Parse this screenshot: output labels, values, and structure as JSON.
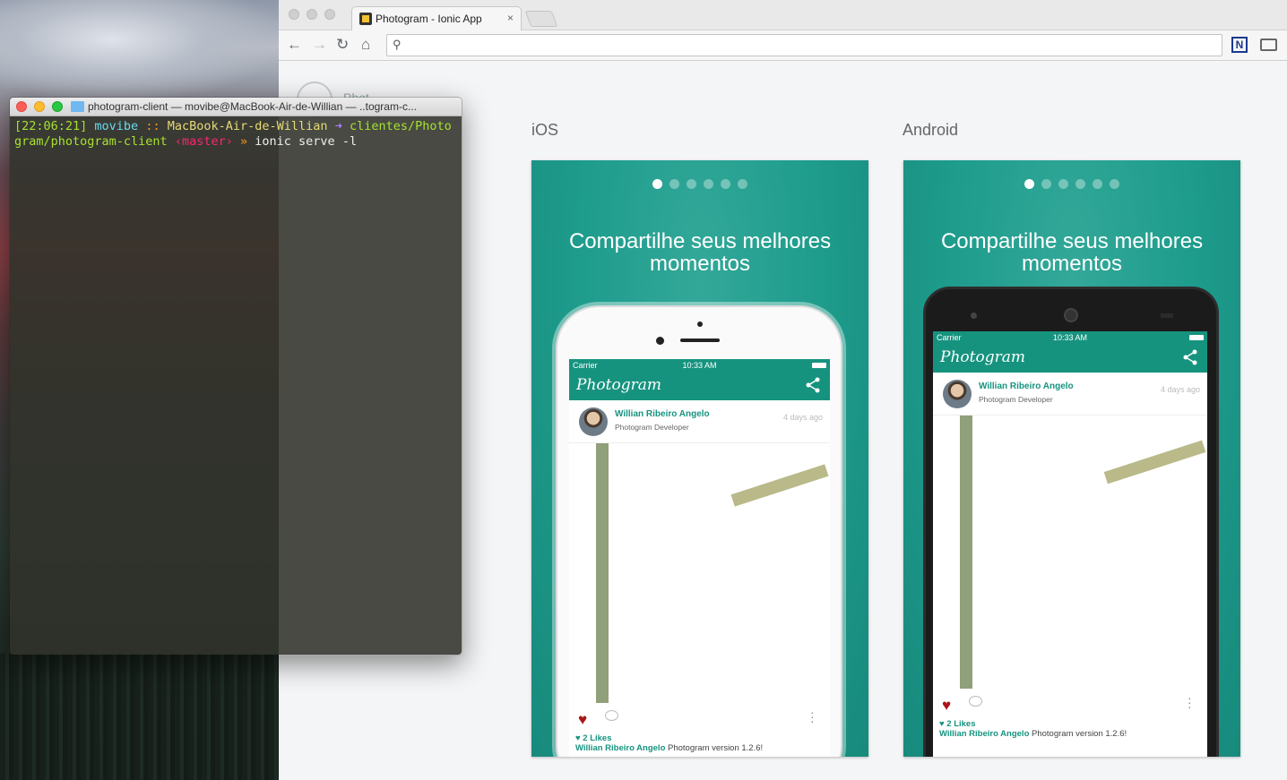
{
  "browser": {
    "tab_title": "Photogram - Ionic App",
    "tab_close": "×",
    "url": "",
    "icons": [
      "back-icon",
      "forward-icon",
      "reload-icon",
      "home-icon",
      "search-icon",
      "extension-n-icon",
      "cast-icon"
    ]
  },
  "page": {
    "logo_text": "Phot",
    "ios_label": "iOS",
    "android_label": "Android"
  },
  "preview": {
    "headline": "Compartilhe seus melhores momentos",
    "slide_count": 6,
    "active_slide": 1
  },
  "app": {
    "carrier": "Carrier",
    "time": "10:33 AM",
    "brand": "Photogram",
    "post": {
      "author": "Willian Ribeiro Angelo",
      "role": "Photogram Developer",
      "time_ago": "4 days ago",
      "likes": "2 Likes",
      "caption_author": "Willian Ribeiro Angelo",
      "caption_text": "Photogram version 1.2.6!"
    }
  },
  "terminal": {
    "window_title": "photogram-client — movibe@MacBook-Air-de-Willian — ..togram-c...",
    "prompt_time": "[22:06:21]",
    "user": "movibe",
    "sep": "::",
    "host": "MacBook-Air-de-Willian",
    "arrow": "➜",
    "path": "clientes/Photogram/photogram-client",
    "branch": "‹master›",
    "prompt_char": "»",
    "command": "ionic serve -l"
  },
  "colors": {
    "accent": "#16937f",
    "preview_bg": "#1e9c8c",
    "heart": "#a81616",
    "terminal_bg": "#30322a"
  }
}
